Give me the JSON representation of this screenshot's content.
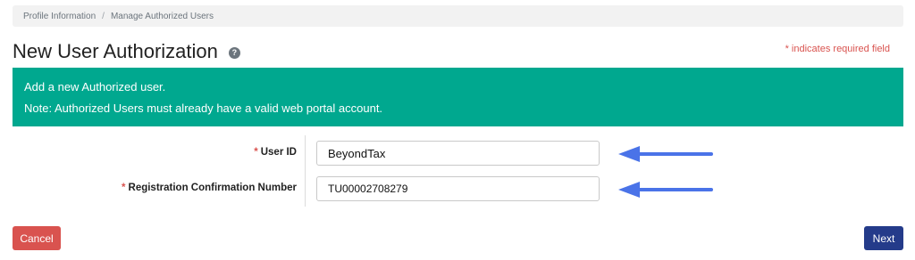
{
  "breadcrumb": {
    "items": [
      "Profile Information",
      "Manage Authorized Users"
    ],
    "separator": "/"
  },
  "header": {
    "title": "New User Authorization",
    "help_icon": "?",
    "required_note": "* indicates required field"
  },
  "info": {
    "line1": "Add a new Authorized user.",
    "line2": "Note: Authorized Users must already have a valid web portal account."
  },
  "form": {
    "user_id": {
      "required_marker": "*",
      "label": "User ID",
      "value": "BeyondTax"
    },
    "confirmation": {
      "required_marker": "*",
      "label": "Registration Confirmation Number",
      "value": "TU00002708279"
    }
  },
  "buttons": {
    "cancel": "Cancel",
    "next": "Next"
  },
  "colors": {
    "info_bg": "#00a88f",
    "cancel_bg": "#d9534f",
    "next_bg": "#243b8a",
    "arrow": "#4a73e8",
    "required": "#d9534f"
  }
}
